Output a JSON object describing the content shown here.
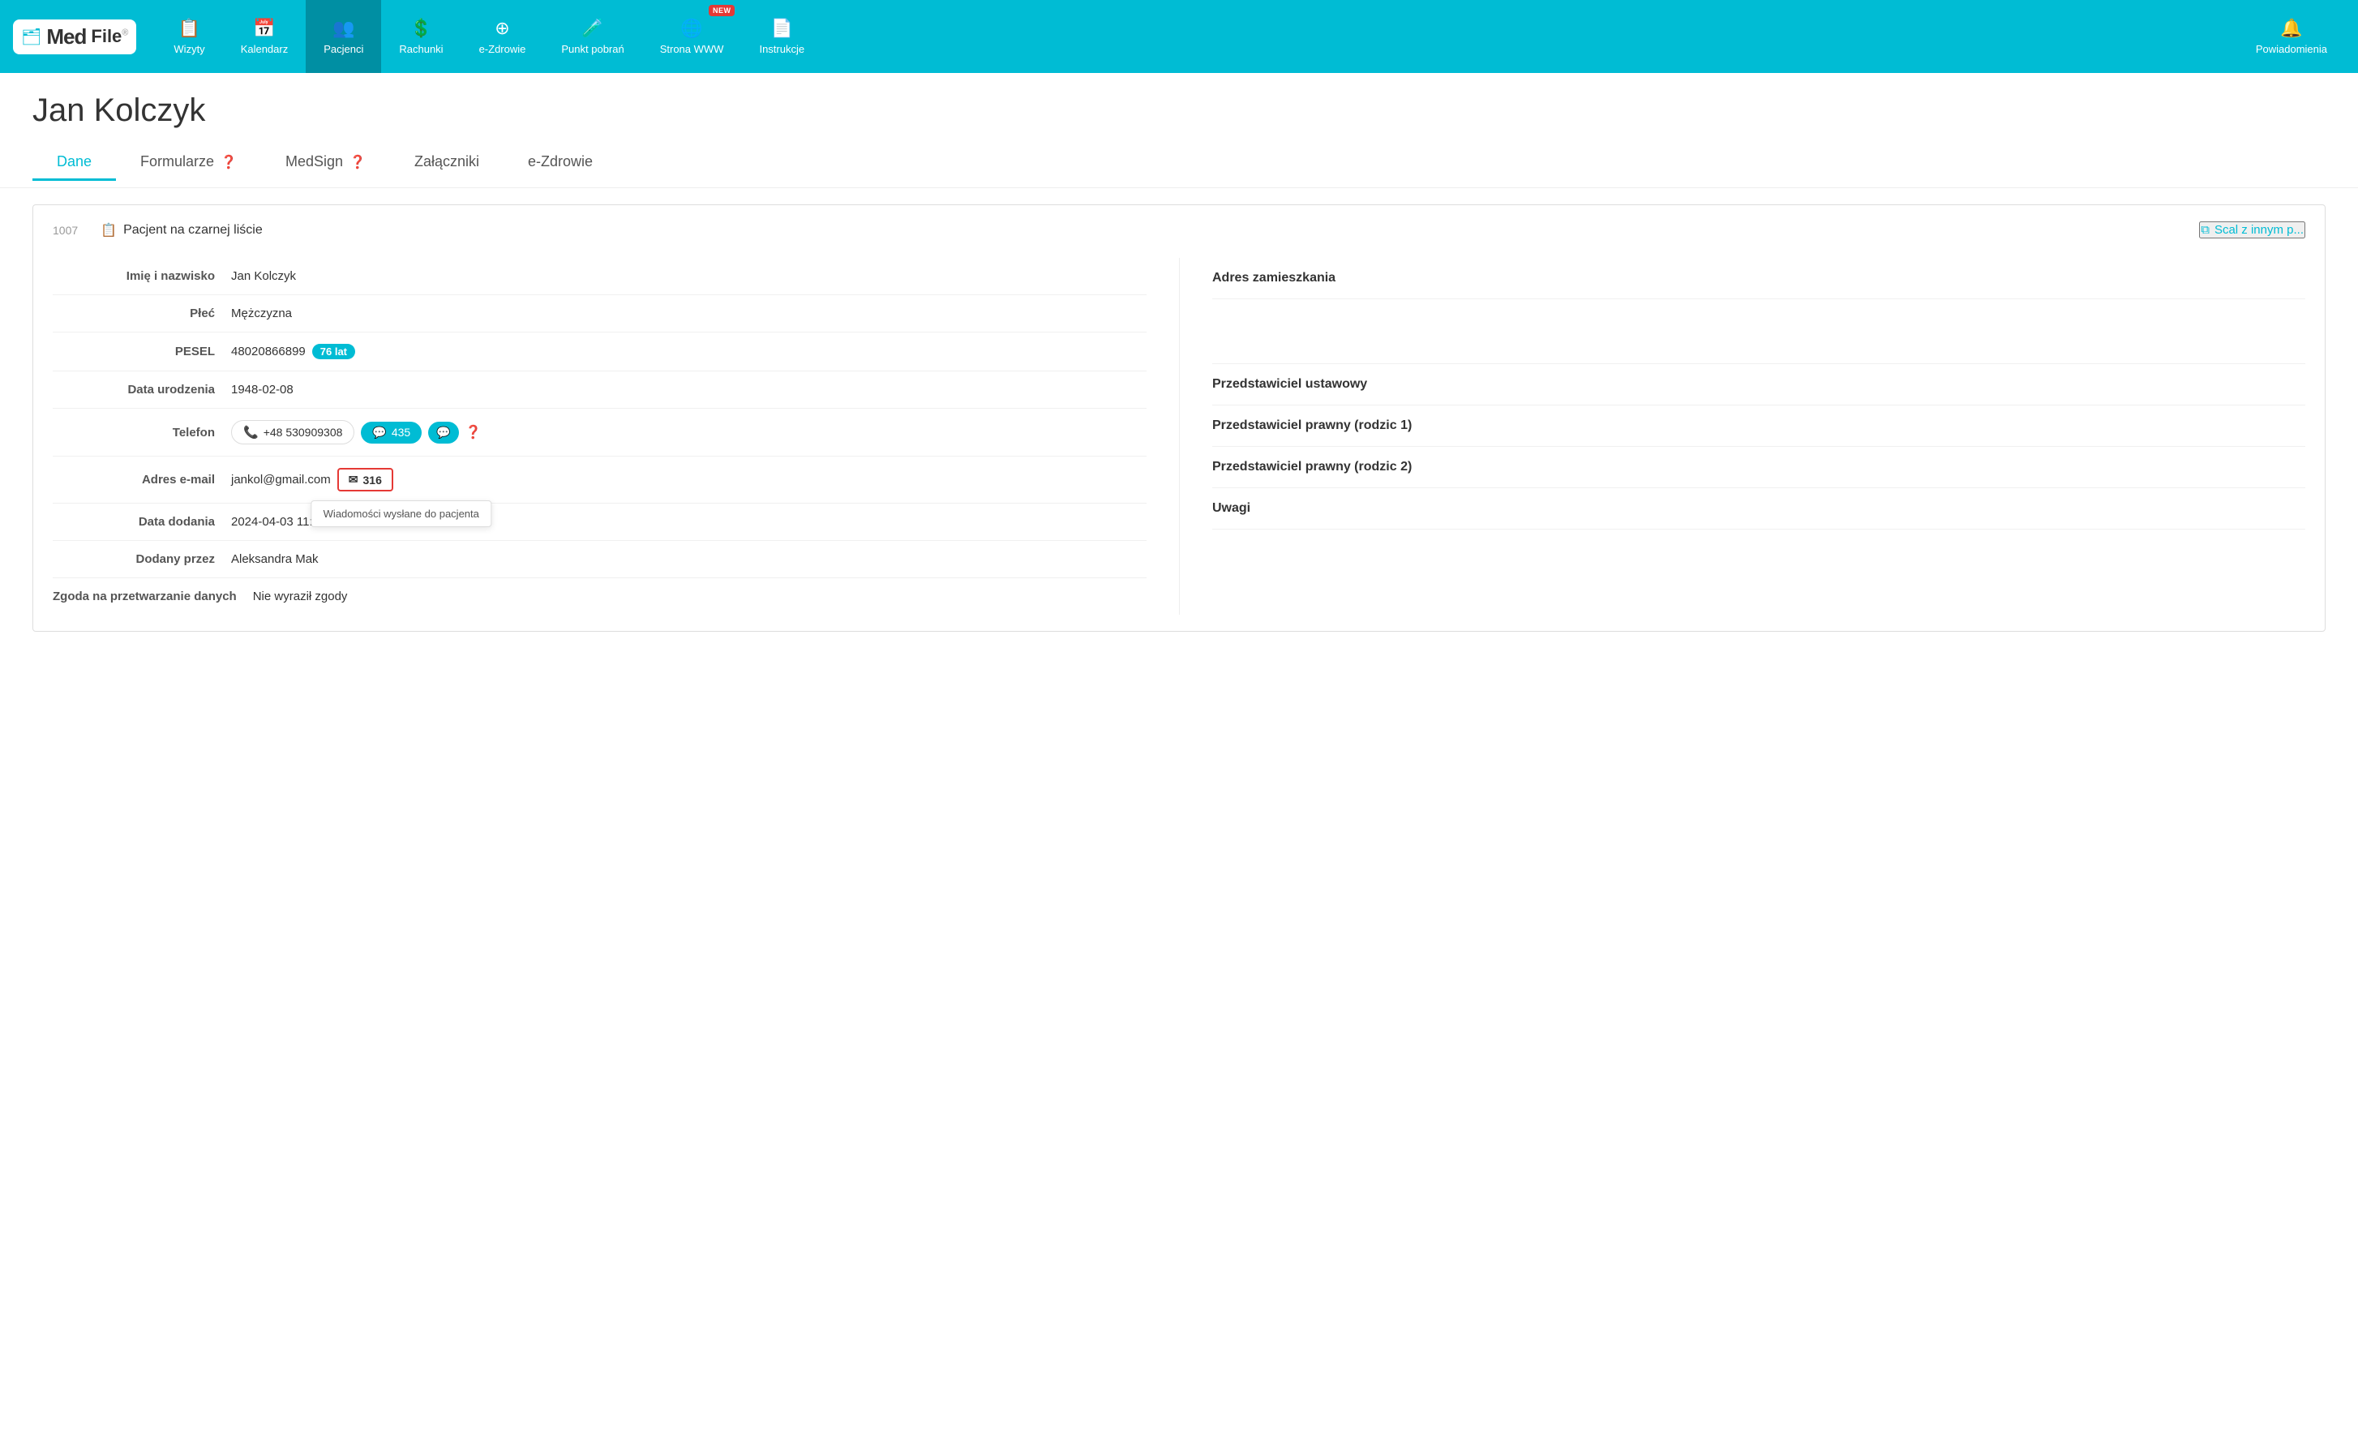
{
  "app": {
    "logo_med": "Med",
    "logo_file": "File",
    "logo_reg": "®"
  },
  "nav": {
    "items": [
      {
        "id": "wizyty",
        "label": "Wizyty",
        "icon": "📋",
        "active": false
      },
      {
        "id": "kalendarz",
        "label": "Kalendarz",
        "icon": "📅",
        "active": false
      },
      {
        "id": "pacjenci",
        "label": "Pacjenci",
        "icon": "👥",
        "active": true
      },
      {
        "id": "rachunki",
        "label": "Rachunki",
        "icon": "💲",
        "active": false
      },
      {
        "id": "ezdrowie",
        "label": "e-Zdrowie",
        "icon": "➕",
        "active": false
      },
      {
        "id": "punkt-pobran",
        "label": "Punkt pobrań",
        "icon": "📋",
        "active": false
      },
      {
        "id": "strona-www",
        "label": "Strona WWW",
        "icon": "🌐",
        "active": false,
        "new": true
      },
      {
        "id": "instrukcje",
        "label": "Instrukcje",
        "icon": "📄",
        "active": false
      },
      {
        "id": "powiadomienia",
        "label": "Powiadomienia",
        "icon": "🔔",
        "active": false
      }
    ]
  },
  "page": {
    "patient_name": "Jan Kolczyk",
    "tabs": [
      {
        "id": "dane",
        "label": "Dane",
        "active": true,
        "help": false
      },
      {
        "id": "formularze",
        "label": "Formularze",
        "active": false,
        "help": true
      },
      {
        "id": "medsign",
        "label": "MedSign",
        "active": false,
        "help": true
      },
      {
        "id": "zalaczniki",
        "label": "Załączniki",
        "active": false,
        "help": false
      },
      {
        "id": "ezdrowie",
        "label": "e-Zdrowie",
        "active": false,
        "help": false
      }
    ]
  },
  "card": {
    "id": "1007",
    "blacklist_icon": "📋",
    "blacklist_label": "Pacjent na czarnej liście",
    "merge_label": "Scal z innym p...",
    "fields": [
      {
        "label": "Imię i nazwisko",
        "value": "Jan Kolczyk",
        "type": "text"
      },
      {
        "label": "Płeć",
        "value": "Mężczyzna",
        "type": "text"
      },
      {
        "label": "PESEL",
        "value": "48020866899",
        "age": "76 lat",
        "type": "pesel"
      },
      {
        "label": "Data urodzenia",
        "value": "1948-02-08",
        "type": "text"
      },
      {
        "label": "Telefon",
        "phone": "+48 530909308",
        "sms_count": "435",
        "type": "phone"
      },
      {
        "label": "Adres e-mail",
        "value": "jankol@gmail.com",
        "email_count": "316",
        "type": "email"
      },
      {
        "label": "Data dodania",
        "value": "2024-04-03 11:23:20",
        "type": "text"
      },
      {
        "label": "Dodany przez",
        "value": "Aleksandra Mak",
        "type": "text"
      },
      {
        "label": "Zgoda na przetwarzanie danych",
        "value": "Nie wyraził zgody",
        "type": "text"
      }
    ],
    "right_labels": [
      "Adres zamieszkania",
      "Przedstawiciel ustawowy",
      "Przedstawiciel prawny (rodzic 1)",
      "Przedstawiciel prawny (rodzic 2)",
      "Uwagi"
    ],
    "tooltip_email": "Wiadomości wysłane do pacjenta"
  }
}
